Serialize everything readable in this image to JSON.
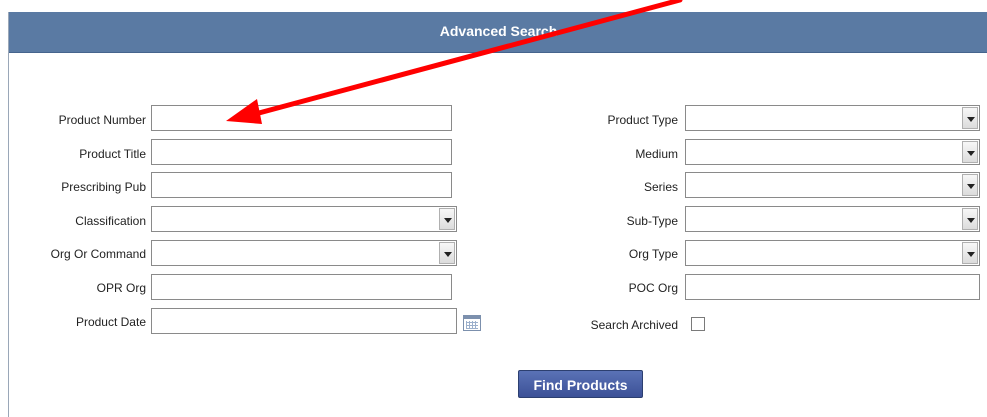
{
  "header": {
    "title": "Advanced Search"
  },
  "left_fields": {
    "product_number": {
      "label": "Product Number",
      "value": ""
    },
    "product_title": {
      "label": "Product Title",
      "value": ""
    },
    "prescribing_pub": {
      "label": "Prescribing Pub",
      "value": ""
    },
    "classification": {
      "label": "Classification",
      "value": ""
    },
    "org_or_command": {
      "label": "Org Or Command",
      "value": ""
    },
    "opr_org": {
      "label": "OPR Org",
      "value": ""
    },
    "product_date": {
      "label": "Product Date",
      "value": ""
    }
  },
  "right_fields": {
    "product_type": {
      "label": "Product Type",
      "value": ""
    },
    "medium": {
      "label": "Medium",
      "value": ""
    },
    "series": {
      "label": "Series",
      "value": ""
    },
    "sub_type": {
      "label": "Sub-Type",
      "value": ""
    },
    "org_type": {
      "label": "Org Type",
      "value": ""
    },
    "poc_org": {
      "label": "POC Org",
      "value": ""
    },
    "search_archived": {
      "label": "Search Archived",
      "checked": false
    }
  },
  "actions": {
    "find_products": "Find Products"
  },
  "annotation": {
    "color": "#ff0000",
    "points_to": "product-number-input"
  },
  "icons": {
    "calendar": "calendar-icon",
    "dropdown": "chevron-down-icon"
  },
  "colors": {
    "header_bg": "#5a7aa3",
    "button_bg": "#3c5197"
  }
}
